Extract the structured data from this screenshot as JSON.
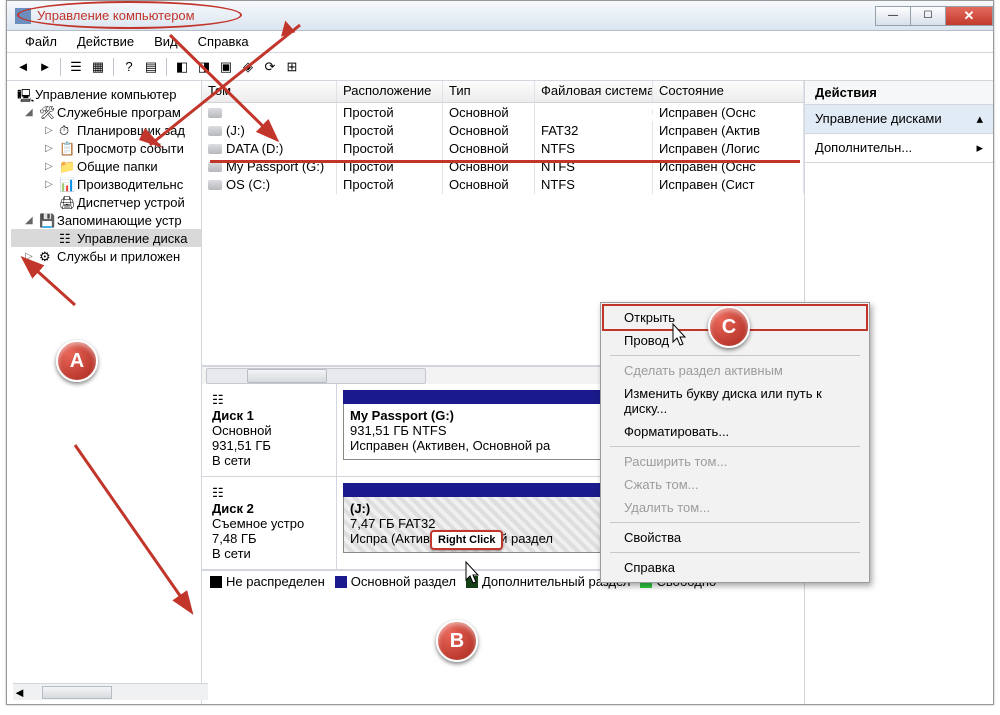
{
  "window_title": "Управление компьютером",
  "menu": [
    "Файл",
    "Действие",
    "Вид",
    "Справка"
  ],
  "tree": {
    "root": "Управление компьютер",
    "sysTools": "Служебные програм",
    "scheduler": "Планировщик зад",
    "eventViewer": "Просмотр событи",
    "sharedFolders": "Общие папки",
    "perfMon": "Производительнс",
    "devMgr": "Диспетчер устрой",
    "storage": "Запоминающие устр",
    "diskMgmt": "Управление диска",
    "services": "Службы и приложен"
  },
  "columns": {
    "name": "Том",
    "layout": "Расположение",
    "type": "Тип",
    "fs": "Файловая система",
    "status": "Состояние"
  },
  "volumes": [
    {
      "name": "",
      "layout": "Простой",
      "type": "Основной",
      "fs": "",
      "status": "Исправен (Оснс"
    },
    {
      "name": "(J:)",
      "layout": "Простой",
      "type": "Основной",
      "fs": "FAT32",
      "status": "Исправен (Актив"
    },
    {
      "name": "DATA (D:)",
      "layout": "Простой",
      "type": "Основной",
      "fs": "NTFS",
      "status": "Исправен (Логис"
    },
    {
      "name": "My Passport (G:)",
      "layout": "Простой",
      "type": "Основной",
      "fs": "NTFS",
      "status": "Исправен (Оснс"
    },
    {
      "name": "OS (C:)",
      "layout": "Простой",
      "type": "Основной",
      "fs": "NTFS",
      "status": "Исправен (Сист"
    }
  ],
  "actions": {
    "header": "Действия",
    "diskMgmt": "Управление дисками",
    "more": "Дополнительн..."
  },
  "disk1": {
    "title": "Диск 1",
    "type": "Основной",
    "size": "931,51 ГБ",
    "state": "В сети",
    "volName": "My Passport  (G:)",
    "volInfo": "931,51 ГБ NTFS",
    "volStatus": "Исправен (Активен, Основной ра"
  },
  "disk2": {
    "title": "Диск 2",
    "type": "Съемное устро",
    "size": "7,48 ГБ",
    "state": "В сети",
    "volName": "(J:)",
    "volInfo": "7,47 ГБ FAT32",
    "volStatus": "Испра         (Активен   Основной раздел"
  },
  "legend": {
    "unalloc": "Не распределен",
    "primary": "Основной раздел",
    "extended": "Дополнительный раздел",
    "free": "Свободно"
  },
  "ctx": {
    "open": "Открыть",
    "explorer": "Провод",
    "makeActive": "Сделать раздел активным",
    "changeLetter": "Изменить букву диска или путь к диску...",
    "format": "Форматировать...",
    "extend": "Расширить том...",
    "shrink": "Сжать том...",
    "delete": "Удалить том...",
    "properties": "Свойства",
    "help": "Справка"
  },
  "tooltip_rightclick": "Right Click",
  "badges": {
    "a": "A",
    "b": "B",
    "c": "C"
  }
}
